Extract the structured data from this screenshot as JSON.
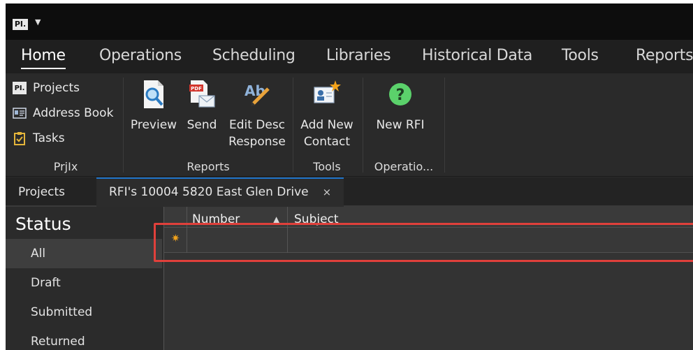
{
  "titlebar": {
    "logo": "PI.",
    "qa_arrow": "▼"
  },
  "ribbon_tabs": [
    "Home",
    "Operations",
    "Scheduling",
    "Libraries",
    "Historical Data",
    "Tools",
    "Reports"
  ],
  "ribbon": {
    "prjix": {
      "label": "PrjIx",
      "items": [
        {
          "label": "Projects",
          "icon": "PI."
        },
        {
          "label": "Address Book",
          "icon": "address-book-icon"
        },
        {
          "label": "Tasks",
          "icon": "clipboard-icon"
        }
      ]
    },
    "reports": {
      "label": "Reports",
      "preview": "Preview",
      "send": "Send",
      "edit_line1": "Edit Desc",
      "edit_line2": "Response",
      "pdf_badge": "PDF"
    },
    "tools": {
      "label": "Tools",
      "line1": "Add New",
      "line2": "Contact"
    },
    "operations": {
      "label": "Operatio...",
      "new_rfi": "New RFI"
    }
  },
  "doctabs": {
    "projects": "Projects",
    "active": "RFI's 10004 5820 East Glen Drive",
    "close": "×"
  },
  "status": {
    "title": "Status",
    "items": [
      "All",
      "Draft",
      "Submitted",
      "Returned"
    ]
  },
  "grid": {
    "columns": [
      "Number",
      "Subject"
    ],
    "sort_indicator": "▲",
    "new_row_marker": "✷"
  },
  "colors": {
    "accent": "#1e73c8",
    "highlight": "#e0403b",
    "new_marker": "#f3a31b"
  }
}
